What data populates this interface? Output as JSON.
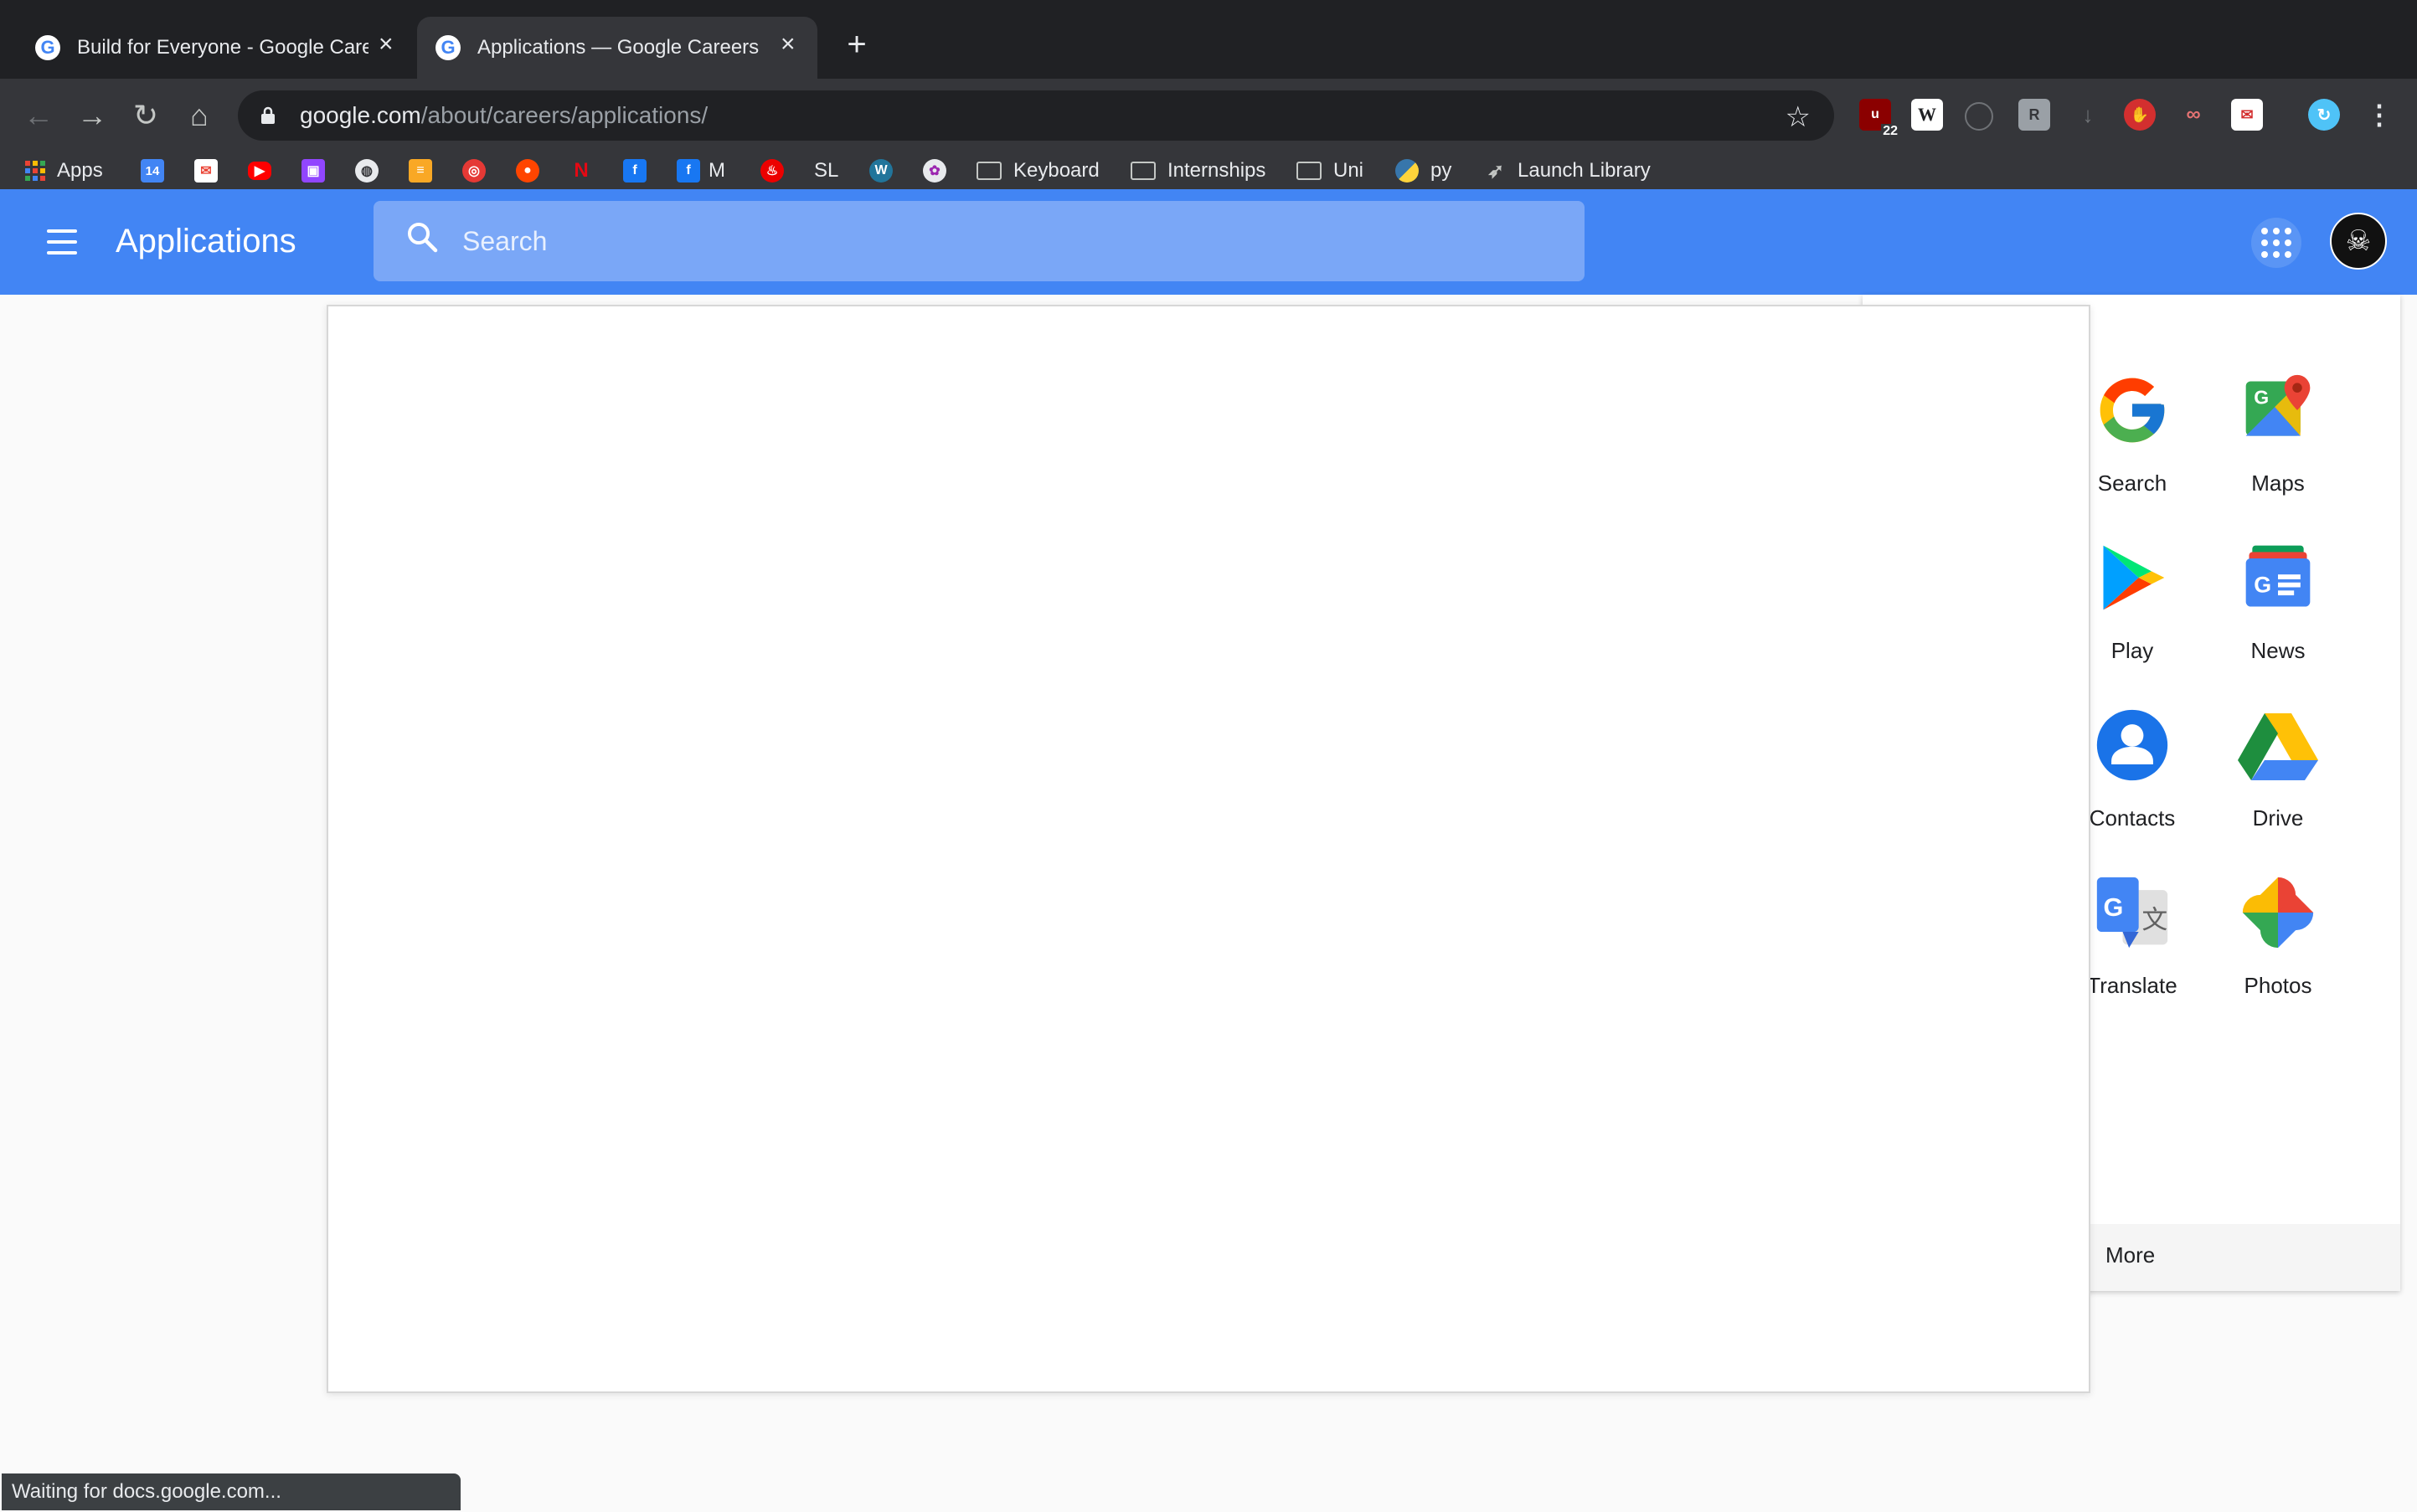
{
  "browser": {
    "tabs": [
      {
        "title": "Build for Everyone - Google Care",
        "active": false
      },
      {
        "title": "Applications — Google Careers",
        "active": true
      }
    ],
    "url_host": "google.com",
    "url_path": "/about/careers/applications/",
    "extension_badge": "22",
    "bookmarks": {
      "apps": "Apps",
      "calendar_date": "14",
      "m": "M",
      "sl": "SL",
      "keyboard": "Keyboard",
      "internships": "Internships",
      "uni": "Uni",
      "py": "py",
      "launch_library": "Launch Library"
    },
    "status": "Waiting for docs.google.com..."
  },
  "header": {
    "title": "Applications",
    "search_placeholder": "Search"
  },
  "app_panel": {
    "apps": [
      {
        "label": "Search",
        "icon": "google-g-icon"
      },
      {
        "label": "Maps",
        "icon": "maps-icon"
      },
      {
        "label": "Play",
        "icon": "play-icon"
      },
      {
        "label": "News",
        "icon": "news-icon"
      },
      {
        "label": "Contacts",
        "icon": "contacts-icon"
      },
      {
        "label": "Drive",
        "icon": "drive-icon"
      },
      {
        "label": "Translate",
        "icon": "translate-icon"
      },
      {
        "label": "Photos",
        "icon": "photos-icon"
      }
    ],
    "more_label": "More"
  },
  "colors": {
    "brand_blue": "#4285f4",
    "chrome_dark": "#202124",
    "chrome_toolbar": "#35363a"
  }
}
